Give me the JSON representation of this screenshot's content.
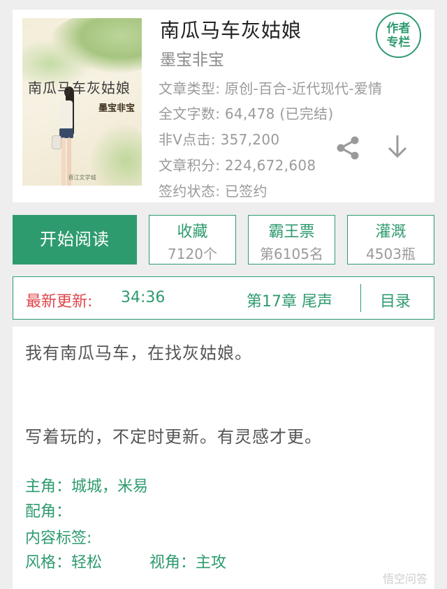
{
  "book": {
    "title": "南瓜马车灰姑娘",
    "author": "墨宝非宝",
    "type": "文章类型: 原创-百合-近代现代-爱情",
    "words": "全文字数: 64,478 (已完结)",
    "clicks": "非V点击: 357,200",
    "score": "文章积分: 224,672,608",
    "sign": "签约状态: 已签约"
  },
  "cover": {
    "title": "南瓜马车灰姑娘",
    "author": "墨宝非宝",
    "publisher": "晋江文学城"
  },
  "author_badge": {
    "line1": "作者",
    "line2": "专栏"
  },
  "icons": {
    "share": "share-icon",
    "download": "download-icon"
  },
  "actions": {
    "read_label": "开始阅读",
    "collect": {
      "label": "收藏",
      "value": "7120个"
    },
    "vote": {
      "label": "霸王票",
      "value": "第6105名"
    },
    "water": {
      "label": "灌溉",
      "value": "4503瓶"
    }
  },
  "update": {
    "label": "最新更新:",
    "time": "34:36",
    "chapter": "第17章  尾声",
    "toc": "目录"
  },
  "description": {
    "line1": "我有南瓜马车，在找灰姑娘。",
    "line2": "写着玩的，不定时更新。有灵感才更。",
    "main": "主角：城城，米易",
    "support": "配角：",
    "content_tags": "内容标签:",
    "style": "风格：轻松",
    "view": "视角：主攻"
  },
  "watermark": "悟空问答",
  "colors": {
    "accent": "#2e9b6e",
    "alert": "#e0454a",
    "muted": "#9a9a9a"
  }
}
